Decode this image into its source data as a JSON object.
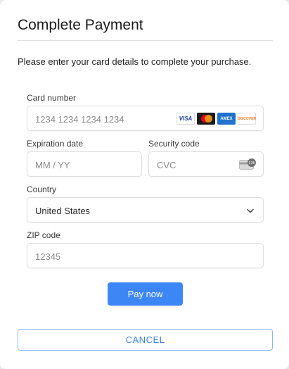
{
  "dialog": {
    "title": "Complete Payment",
    "intro": "Please enter your card details to complete your purchase."
  },
  "form": {
    "card_number": {
      "label": "Card number",
      "placeholder": "1234 1234 1234 1234",
      "brands": [
        "VISA",
        "mastercard",
        "AMEX",
        "DISCOVER"
      ]
    },
    "expiration": {
      "label": "Expiration date",
      "placeholder": "MM / YY"
    },
    "security": {
      "label": "Security code",
      "placeholder": "CVC",
      "icon_text": "135"
    },
    "country": {
      "label": "Country",
      "value": "United States"
    },
    "zip": {
      "label": "ZIP code",
      "placeholder": "12345"
    }
  },
  "actions": {
    "pay_label": "Pay now",
    "cancel_label": "CANCEL"
  },
  "colors": {
    "primary": "#3d86f5",
    "cancel_text": "#3d7fe0"
  }
}
